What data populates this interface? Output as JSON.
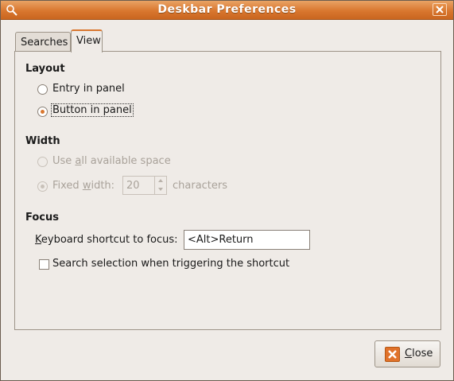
{
  "window": {
    "title": "Deskbar Preferences",
    "accent_color": "#d9772f"
  },
  "tabs": [
    {
      "label": "Searches",
      "active": false
    },
    {
      "label": "View",
      "active": true
    }
  ],
  "layout": {
    "heading": "Layout",
    "options": [
      {
        "label": "Entry in panel",
        "selected": false
      },
      {
        "label": "Button in panel",
        "selected": true
      }
    ]
  },
  "width": {
    "heading": "Width",
    "use_all_pre": "Use ",
    "use_all_mnemonic": "a",
    "use_all_post": "ll available space",
    "fixed_pre": "Fixed ",
    "fixed_mnemonic": "w",
    "fixed_post": "idth:",
    "fixed_value": "20",
    "units": "characters",
    "enabled": false
  },
  "focus": {
    "heading": "Focus",
    "shortcut_mnemonic": "K",
    "shortcut_rest": "eyboard shortcut to focus:",
    "shortcut_value": "<Alt>Return",
    "selection_label": "Search selection when triggering the shortcut",
    "selection_checked": false
  },
  "buttons": {
    "close_mnemonic": "C",
    "close_rest": "lose"
  },
  "icons": {
    "window": "search-icon",
    "titlebar_close": "close-icon",
    "button_close": "close-icon"
  }
}
